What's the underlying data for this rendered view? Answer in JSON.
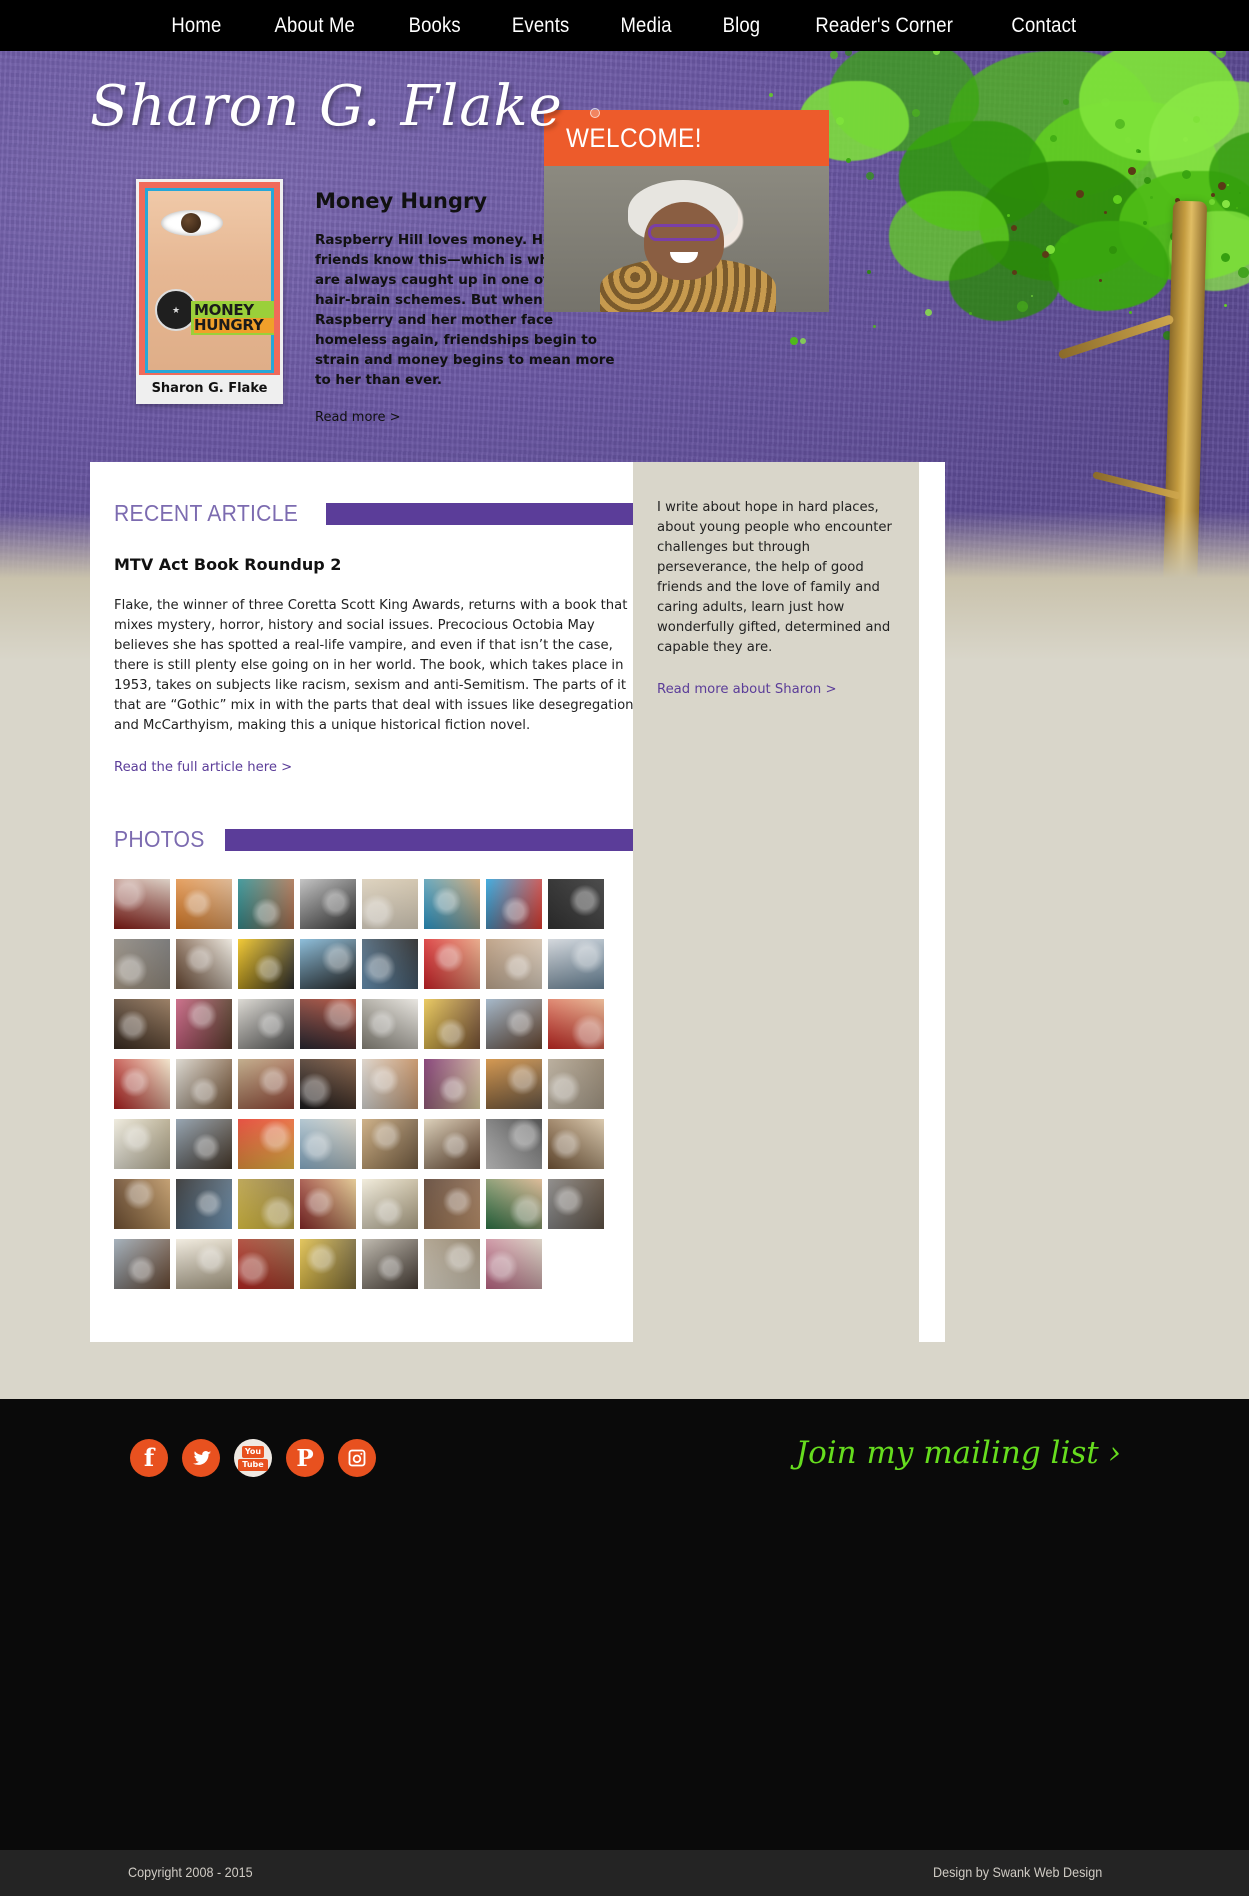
{
  "site": {
    "title": "Sharon G. Flake"
  },
  "nav": {
    "items": [
      {
        "label": "Home",
        "name": "nav-home"
      },
      {
        "label": "About Me",
        "name": "nav-about-me"
      },
      {
        "label": "Books",
        "name": "nav-books"
      },
      {
        "label": "Events",
        "name": "nav-events"
      },
      {
        "label": "Media",
        "name": "nav-media"
      },
      {
        "label": "Blog",
        "name": "nav-blog"
      },
      {
        "label": "Reader's Corner",
        "name": "nav-readers-corner"
      },
      {
        "label": "Contact",
        "name": "nav-contact"
      }
    ]
  },
  "feature": {
    "book_title": "Money Hungry",
    "description": "Raspberry Hill loves money. Her friends know this—which is why they are always caught up in one of her hair-brain schemes. But when Raspberry and her mother face homeless again, friendships begin to strain and money begins to mean more to her than ever.",
    "read_more": "Read more >",
    "cover": {
      "title_line1": "MONEY",
      "title_line2": "HUNGRY",
      "author": "Sharon G. Flake"
    }
  },
  "welcome": {
    "heading": "WELCOME!",
    "bio": "I write about hope in hard places, about young people who encounter challenges but through perseverance, the help of good friends and the love of family and caring adults, learn just how wonderfully gifted, determined and capable they are.",
    "read_more": "Read more about Sharon >"
  },
  "recent_article": {
    "section_label": "RECENT ARTICLE",
    "title": "MTV Act Book Roundup 2",
    "body": "Flake, the winner of three Coretta Scott King Awards, returns with a book that mixes mystery, horror, history and social issues. Precocious Octobia May believes she has spotted a real-life vampire, and even if that isn’t the case, there is still plenty else going on in her world. The book, which takes place in 1953, takes on subjects like racism, sexism and anti-Semitism. The parts of it that are “Gothic” mix in with the parts that deal with issues like desegregation and McCarthyism, making this a unique historical fiction novel.",
    "link": "Read the full article here >"
  },
  "photos": {
    "section_label": "PHOTOS",
    "count": 54,
    "thumbs": [
      {
        "name": "photo-group-on-stage",
        "c1": "#8b1c16",
        "c2": "#d6c9bd"
      },
      {
        "name": "photo-girl-with-book",
        "c1": "#e8842a",
        "c2": "#d9b089"
      },
      {
        "name": "photo-woman-teal-top",
        "c1": "#2e8f92",
        "c2": "#b3724f"
      },
      {
        "name": "photo-bw-portrait",
        "c1": "#bdbdbd",
        "c2": "#3a3a3a"
      },
      {
        "name": "photo-handwritten-note",
        "c1": "#efe6d6",
        "c2": "#cdbfa6"
      },
      {
        "name": "photo-classroom-group",
        "c1": "#2b9fd4",
        "c2": "#c9a271"
      },
      {
        "name": "photo-unstoppable-poster",
        "c1": "#2ba3dc",
        "c2": "#e33b2e"
      },
      {
        "name": "photo-chalkboard",
        "c1": "#1d1d1d",
        "c2": "#4c4c4c"
      },
      {
        "name": "photo-dog-laptop",
        "c1": "#b7a894",
        "c2": "#6a6a6a"
      },
      {
        "name": "photo-woman-bookshelf",
        "c1": "#6b4a33",
        "c2": "#e9e4da"
      },
      {
        "name": "photo-glasses-book-cover",
        "c1": "#f2c41c",
        "c2": "#2d2d2d"
      },
      {
        "name": "photo-dancer-waterfront",
        "c1": "#7fb6d6",
        "c2": "#2a2a2a"
      },
      {
        "name": "photo-dancer-skyline",
        "c1": "#6f9cc0",
        "c2": "#1f1f1f"
      },
      {
        "name": "photo-girl-and-author",
        "c1": "#d8242a",
        "c2": "#e6a27f"
      },
      {
        "name": "photo-signing-table",
        "c1": "#b99a7c",
        "c2": "#e0d3c3"
      },
      {
        "name": "photo-students-reading",
        "c1": "#cfd3d8",
        "c2": "#6d8aa0"
      },
      {
        "name": "photo-books-on-desk",
        "c1": "#3a2c22",
        "c2": "#8e6f52"
      },
      {
        "name": "photo-two-women-smiling",
        "c1": "#c8607f",
        "c2": "#5a3d2c"
      },
      {
        "name": "photo-typewriter",
        "c1": "#d9d6cf",
        "c2": "#5a5a5a"
      },
      {
        "name": "photo-author-speaking",
        "c1": "#2a2a35",
        "c2": "#b0452f"
      },
      {
        "name": "photo-author-portrait",
        "c1": "#8e8a7f",
        "c2": "#e5e2dc"
      },
      {
        "name": "photo-reader-with-book",
        "c1": "#e8c44f",
        "c2": "#7a5436"
      },
      {
        "name": "photo-two-readers",
        "c1": "#9ab0c4",
        "c2": "#6b4a33"
      },
      {
        "name": "photo-group-red-wall",
        "c1": "#cf2a25",
        "c2": "#e4b08a"
      },
      {
        "name": "photo-octobia-may-cover",
        "c1": "#b5201f",
        "c2": "#f0e2c6"
      },
      {
        "name": "photo-student-holding-book",
        "c1": "#d8d4cb",
        "c2": "#7b5b3e"
      },
      {
        "name": "photo-library-group",
        "c1": "#bba47f",
        "c2": "#9a4a3a"
      },
      {
        "name": "photo-woman-dark-top",
        "c1": "#1c1c20",
        "c2": "#7a5338"
      },
      {
        "name": "photo-kids-raising-books",
        "c1": "#e0e0dd",
        "c2": "#c08a5c"
      },
      {
        "name": "photo-sign-hope",
        "c1": "#7a2f6b",
        "c2": "#e4d7a8"
      },
      {
        "name": "photo-event-attendees",
        "c1": "#cf8b3a",
        "c2": "#6c5a48"
      },
      {
        "name": "photo-reading-session",
        "c1": "#d3c9b8",
        "c2": "#8a7a64"
      },
      {
        "name": "photo-handwritten-sign",
        "c1": "#f2efe2",
        "c2": "#b4a98c"
      },
      {
        "name": "photo-family-group",
        "c1": "#8a9aa8",
        "c2": "#4a3b2c"
      },
      {
        "name": "photo-fan-sign",
        "c1": "#e23a2a",
        "c2": "#f0c24a"
      },
      {
        "name": "photo-lighthouse",
        "c1": "#8fb6d2",
        "c2": "#d3cdbf"
      },
      {
        "name": "photo-cardboard-sign",
        "c1": "#c9a87a",
        "c2": "#7a6246"
      },
      {
        "name": "photo-teen-with-book",
        "c1": "#d8cbb2",
        "c2": "#6b4a33"
      },
      {
        "name": "photo-laptop-sign",
        "c1": "#dcdcdc",
        "c2": "#3c3c3c"
      },
      {
        "name": "photo-bookstore-event",
        "c1": "#7a5a3a",
        "c2": "#d5c2a4"
      },
      {
        "name": "photo-store-interior",
        "c1": "#6a4a2e",
        "c2": "#c9a06a"
      },
      {
        "name": "photo-youth-group",
        "c1": "#2a2a2a",
        "c2": "#7aa2c4"
      },
      {
        "name": "photo-yellow-sign",
        "c1": "#efd24a",
        "c2": "#8a7440"
      },
      {
        "name": "photo-book-display",
        "c1": "#8e2b2b",
        "c2": "#e0c48a"
      },
      {
        "name": "photo-handheld-note",
        "c1": "#f0ead8",
        "c2": "#b8ab8d"
      },
      {
        "name": "photo-smiling-teen",
        "c1": "#5a4030",
        "c2": "#c79a72"
      },
      {
        "name": "photo-girl-green-shirt",
        "c1": "#2f7a4a",
        "c2": "#d9b38c"
      },
      {
        "name": "photo-knit-hat-portrait",
        "c1": "#8a8a8a",
        "c2": "#5a4a3a"
      },
      {
        "name": "photo-selfie-pair",
        "c1": "#9aa8b4",
        "c2": "#6a4a33"
      },
      {
        "name": "photo-letter-page",
        "c1": "#efe9dc",
        "c2": "#b2a68c"
      },
      {
        "name": "photo-boy-red-shirt",
        "c1": "#c22a24",
        "c2": "#8a5a3a"
      },
      {
        "name": "photo-yellow-sweater",
        "c1": "#e4c24a",
        "c2": "#7a6a3a"
      },
      {
        "name": "photo-young-woman",
        "c1": "#b8b2a6",
        "c2": "#4a4038"
      },
      {
        "name": "photo-quote-card",
        "c1": "#efe8d8",
        "c2": "#8a7a62"
      },
      {
        "name": "photo-author-pink-dress",
        "c1": "#c46a8a",
        "c2": "#d5cdbe"
      }
    ]
  },
  "footer": {
    "social": [
      {
        "name": "facebook-icon",
        "glyph": "f",
        "label": "Facebook"
      },
      {
        "name": "twitter-icon",
        "glyph": "ᵗ",
        "label": "Twitter"
      },
      {
        "name": "youtube-icon",
        "glyph": "You Tube",
        "label": "YouTube"
      },
      {
        "name": "pinterest-icon",
        "glyph": "P",
        "label": "Pinterest"
      },
      {
        "name": "instagram-icon",
        "glyph": "▣",
        "label": "Instagram"
      }
    ],
    "mailing_list": "Join my mailing list ›",
    "copyright": "Copyright 2008 - 2015",
    "credit": "Design by Swank Web Design"
  },
  "colors": {
    "accent_orange": "#ED5B2B",
    "accent_purple": "#5B3D99",
    "accent_purple_light": "#7C6BB0",
    "accent_green": "#66DD1E",
    "beige": "#D9D6CA",
    "black": "#0a0a0a"
  }
}
